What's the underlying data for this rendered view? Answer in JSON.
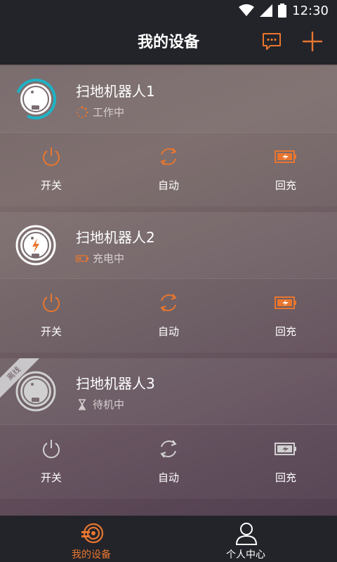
{
  "status_bar": {
    "time": "12:30"
  },
  "header": {
    "title": "我的设备"
  },
  "colors": {
    "accent": "#e8762f",
    "offline": "#d0d0d0",
    "bar": "#23242a"
  },
  "devices": [
    {
      "name": "扫地机器人1",
      "status": "工作中",
      "status_icon": "spinner-icon",
      "state": "working",
      "actions": {
        "power": "开关",
        "auto": "自动",
        "recharge": "回充"
      }
    },
    {
      "name": "扫地机器人2",
      "status": "充电中",
      "status_icon": "battery-icon",
      "state": "charging",
      "actions": {
        "power": "开关",
        "auto": "自动",
        "recharge": "回充"
      }
    },
    {
      "name": "扫地机器人3",
      "status": "待机中",
      "status_icon": "hourglass-icon",
      "state": "offline",
      "badge": "离线",
      "actions": {
        "power": "开关",
        "auto": "自动",
        "recharge": "回充"
      }
    }
  ],
  "bottom_nav": [
    {
      "label": "我的设备",
      "icon": "robot-icon",
      "active": true
    },
    {
      "label": "个人中心",
      "icon": "user-icon",
      "active": false
    }
  ]
}
